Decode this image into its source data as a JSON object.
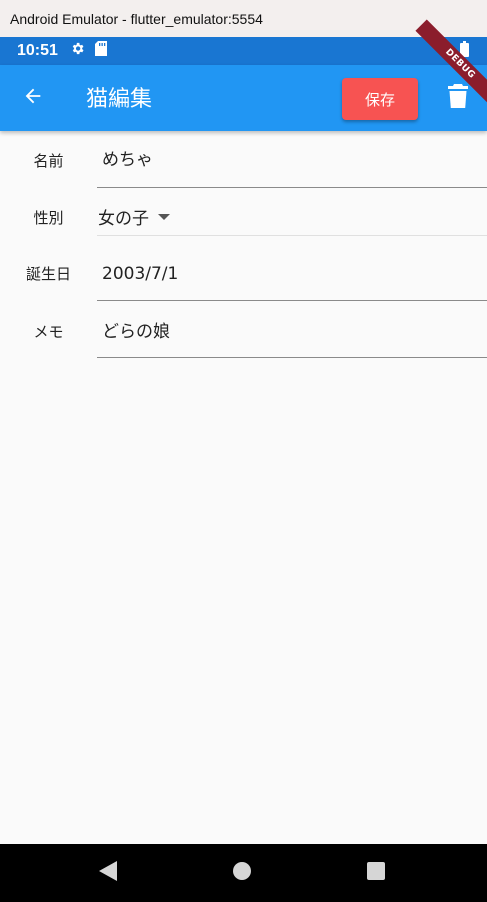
{
  "window": {
    "title": "Android Emulator - flutter_emulator:5554"
  },
  "status_bar": {
    "time": "10:51"
  },
  "app_bar": {
    "title": "猫編集",
    "save_label": "保存",
    "debug_label": "DEBUG"
  },
  "form": {
    "name": {
      "label": "名前",
      "value": "めちゃ"
    },
    "gender": {
      "label": "性別",
      "value": "女の子"
    },
    "birthday": {
      "label": "誕生日",
      "value": "2003/7/1"
    },
    "memo": {
      "label": "メモ",
      "value": "どらの娘"
    }
  },
  "colors": {
    "status_bar": "#1976d2",
    "app_bar": "#2196f3",
    "save_button": "#f75352",
    "debug_banner": "#8b1d2c"
  },
  "icons": {
    "back": "arrow-back-icon",
    "delete": "trash-icon",
    "settings": "gear-icon",
    "sd_card": "sd-card-icon",
    "wifi": "wifi-icon",
    "battery": "battery-icon",
    "nav_back": "triangle-back-icon",
    "nav_home": "circle-home-icon",
    "nav_recents": "square-recents-icon"
  }
}
